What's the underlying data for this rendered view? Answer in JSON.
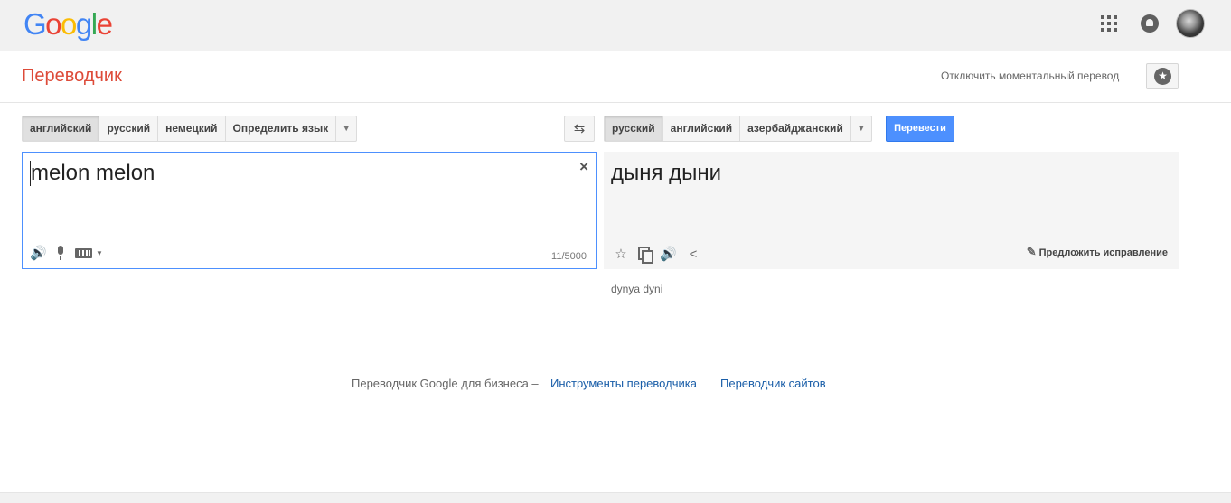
{
  "header": {
    "logo_letters": [
      {
        "char": "G",
        "color": "#4285f4"
      },
      {
        "char": "o",
        "color": "#ea4335"
      },
      {
        "char": "o",
        "color": "#fbbc05"
      },
      {
        "char": "g",
        "color": "#4285f4"
      },
      {
        "char": "l",
        "color": "#34a853"
      },
      {
        "char": "e",
        "color": "#ea4335"
      }
    ],
    "icons": [
      "apps-grid-icon",
      "notifications-bell-icon",
      "account-avatar"
    ]
  },
  "app": {
    "title": "Переводчик",
    "instant_toggle": "Отключить моментальный перевод",
    "star_icon": "★"
  },
  "source_langs": {
    "items": [
      "английский",
      "русский",
      "немецкий",
      "Определить язык"
    ],
    "selected": "английский",
    "dropdown_icon": "▼"
  },
  "target_langs": {
    "items": [
      "русский",
      "английский",
      "азербайджанский"
    ],
    "selected": "русский",
    "dropdown_icon": "▼"
  },
  "swap_icon": "⇆",
  "translate_button": "Перевести",
  "source": {
    "text": "melon melon",
    "clear_icon": "×",
    "speaker_icon": "🔊",
    "char_count": "11/5000",
    "kbd_arrow": "▼"
  },
  "result": {
    "text": "дыня дыни",
    "star_icon": "☆",
    "speaker_icon": "🔊",
    "share_icon": "<",
    "suggest_label": "Предложить исправление",
    "pencil_icon": "✎",
    "transliteration": "dynya dyni"
  },
  "footer": {
    "prefix": "Переводчик Google для бизнеса –",
    "link1": "Инструменты переводчика",
    "link2": "Переводчик сайтов"
  },
  "colors": {
    "accent_red": "#dd4b39",
    "button_blue": "#4d90fe",
    "link_blue": "#1a5ea8"
  }
}
